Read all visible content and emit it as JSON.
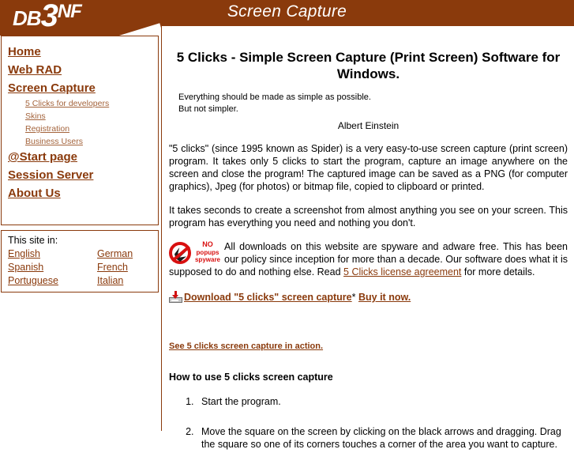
{
  "header": {
    "logo": {
      "part1": "DB",
      "part2": "3",
      "part3": "NF"
    },
    "title": "Screen Capture"
  },
  "colors": {
    "brand_brown": "#8a3a0c",
    "link_brown": "#8a3a0c",
    "sub_link_brown": "#a4643c",
    "alert_red": "#d81010"
  },
  "sidebar": {
    "items": [
      {
        "label": "Home",
        "level": "main"
      },
      {
        "label": "Web RAD",
        "level": "main"
      },
      {
        "label": "Screen Capture",
        "level": "main"
      },
      {
        "label": "5 Clicks for developers",
        "level": "sub"
      },
      {
        "label": "Skins",
        "level": "sub"
      },
      {
        "label": "Registration",
        "level": "sub"
      },
      {
        "label": "Business Users",
        "level": "sub"
      },
      {
        "label": "@Start page",
        "level": "main"
      },
      {
        "label": "Session Server",
        "level": "main"
      },
      {
        "label": "About Us",
        "level": "main"
      }
    ],
    "language_box": {
      "title": "This site in:",
      "languages": [
        "English",
        "German",
        "Spanish",
        "French",
        "Portuguese",
        "Italian"
      ]
    }
  },
  "main": {
    "page_title": "5 Clicks - Simple Screen Capture (Print Screen) Software for Windows.",
    "quote_line1": "Everything should be made as simple as possible.",
    "quote_line2": "But not simpler.",
    "quote_author": "Albert Einstein",
    "paragraph1": "\"5 clicks\" (since 1995 known as Spider) is a very easy-to-use screen capture (print screen) program. It takes only 5 clicks to start the program, capture an image anywhere on the screen and close the program! The captured image can be saved as a PNG (for computer graphics), Jpeg (for photos) or bitmap file, copied to clipboard or printed.",
    "paragraph2": "It takes seconds to create a screenshot from almost anything you see on your screen. This program has everything you need and nothing you don't.",
    "spyware_badge": {
      "word_no": "NO",
      "word_popups": "popups",
      "word_spyware": "spyware",
      "icon_name": "no-popups-spyware-icon"
    },
    "spyware_text_part1": "All downloads on this website are spyware and adware free. This has been our policy since inception for more than a decade. Our software does what it is supposed to do and nothing else. Read ",
    "spyware_license_link": "5 Clicks license agreement",
    "spyware_text_part2": " for more details.",
    "download_link": "Download \"5 clicks\" screen capture",
    "download_separator": "*",
    "buy_link": "Buy it now.",
    "action_link": "See 5 clicks screen capture in action.",
    "howto_heading": "How to use 5 clicks screen capture",
    "howto_steps": [
      "Start the program.",
      "Move the square on the screen by clicking on the black arrows and dragging. Drag the square so one of its corners touches a corner of the area you want to capture."
    ]
  }
}
